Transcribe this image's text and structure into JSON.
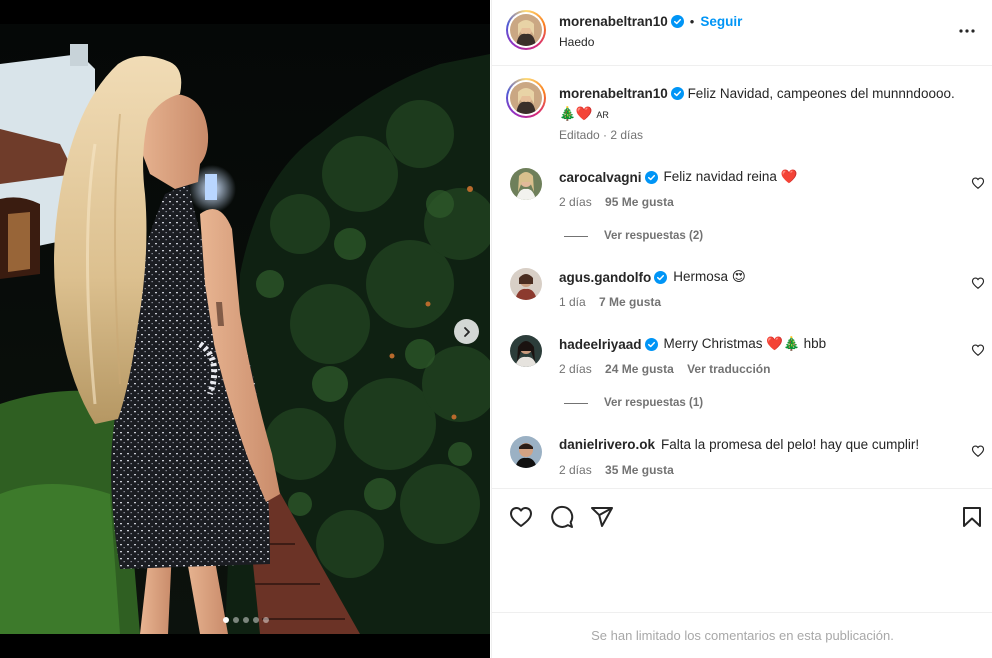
{
  "post": {
    "author": "morenabeltran10",
    "follow_label": "Seguir",
    "location": "Haedo",
    "caption_text": "Feliz Navidad, campeones del munnndoooo.",
    "caption_emoji": "🎄❤️",
    "caption_flag": "AR",
    "caption_meta": "Editado · 2 días",
    "media_position": {
      "current": 1,
      "total": 5
    }
  },
  "comments": [
    {
      "user": "carocalvagni",
      "text": "Feliz navidad reina ❤️",
      "time": "2 días",
      "likes": "95 Me gusta",
      "replies": "Ver respuestas (2)"
    },
    {
      "user": "agus.gandolfo",
      "text": "Hermosa 😍",
      "time": "1 día",
      "likes": "7 Me gusta"
    },
    {
      "user": "hadeelriyaad",
      "text": "Merry Christmas ❤️🎄 hbb",
      "time": "2 días",
      "likes": "24 Me gusta",
      "translate": "Ver traducción",
      "replies": "Ver respuestas (1)"
    },
    {
      "user": "danielrivero.ok",
      "text": "Falta la promesa del pelo! hay que cumplir!",
      "time": "2 días",
      "likes": "35 Me gusta"
    }
  ],
  "footer_notice": "Se han limitado los comentarios en esta publicación.",
  "colors": {
    "accent": "#0095f6",
    "verified": "#0095f6",
    "muted": "#737373",
    "heart": "#e0142b"
  },
  "icons": [
    "more-icon",
    "verified-icon",
    "heart-icon",
    "comment-icon",
    "share-icon",
    "save-icon",
    "chevron-right-icon"
  ]
}
